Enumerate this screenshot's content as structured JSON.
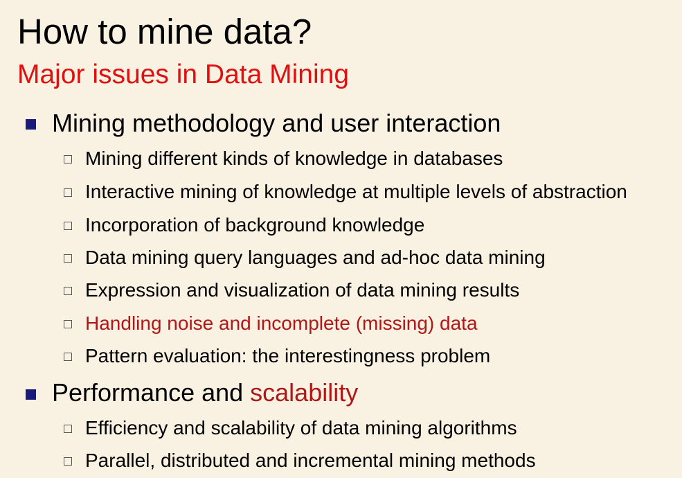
{
  "slide": {
    "title": "How to mine data?",
    "subtitle": "Major issues in Data Mining",
    "sections": [
      {
        "heading": "Mining methodology and user interaction",
        "items": [
          {
            "label": "Mining different kinds of knowledge in databases"
          },
          {
            "label": "Interactive mining of knowledge at multiple levels of abstraction"
          },
          {
            "label": "Incorporation of background knowledge"
          },
          {
            "label": "Data mining query languages and ad-hoc data mining"
          },
          {
            "label": "Expression and visualization of data mining results"
          },
          {
            "label": "Handling noise and incomplete (missing) data",
            "highlight": true
          },
          {
            "label": "Pattern evaluation: the interestingness problem"
          }
        ]
      },
      {
        "heading_prefix": "Performance and ",
        "heading_highlight": "scalability",
        "items": [
          {
            "label": "Efficiency and scalability of data mining algorithms"
          },
          {
            "label": "Parallel, distributed and incremental mining methods"
          }
        ]
      }
    ]
  },
  "colors": {
    "background": "#f9f1e2",
    "title": "#000000",
    "subtitle": "#e01010",
    "highlight": "#b01818",
    "main_bullet": "#1a1a7a",
    "sub_bullet_border": "#555555"
  }
}
